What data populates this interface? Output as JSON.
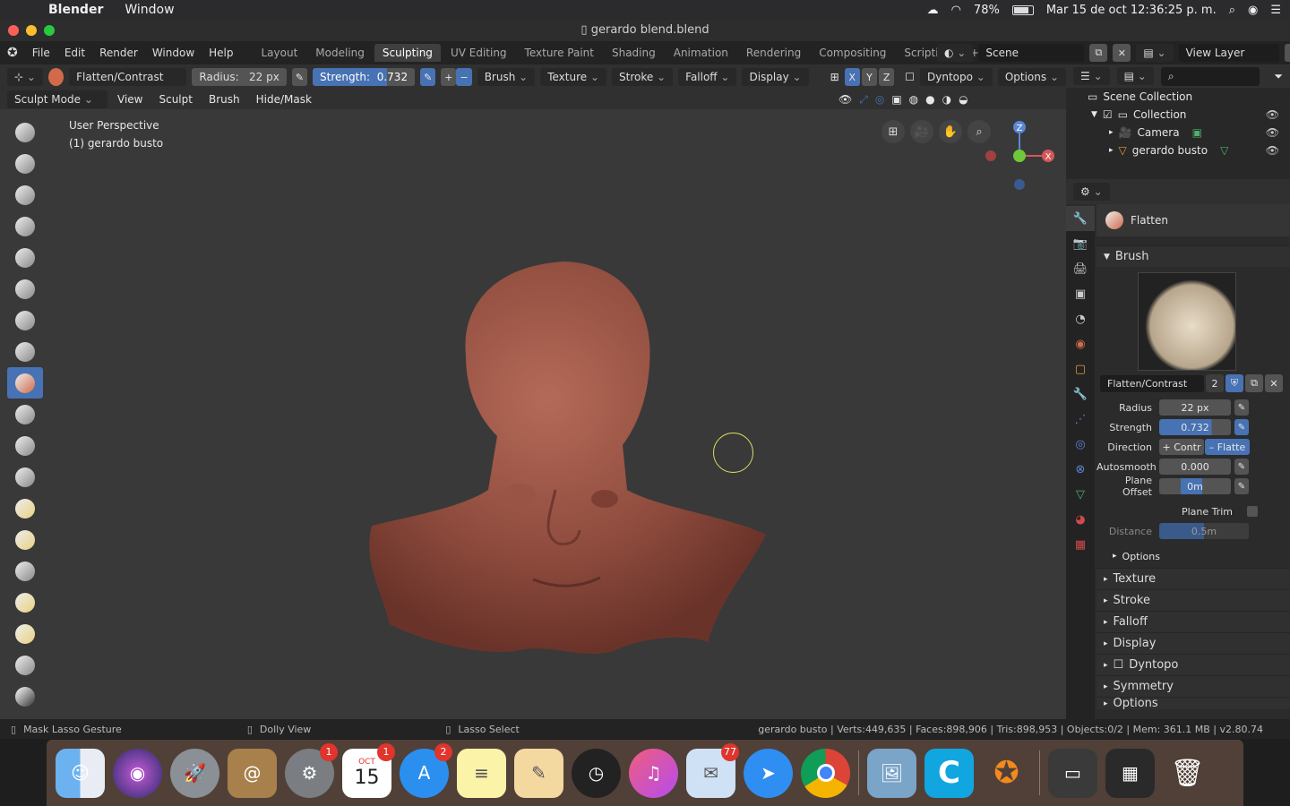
{
  "menubar": {
    "app": "Blender",
    "window": "Window",
    "battery": "78%",
    "datetime": "Mar 15 de oct  12:36:25 p. m."
  },
  "titlebar": {
    "title": "gerardo blend.blend"
  },
  "topmenu": [
    "File",
    "Edit",
    "Render",
    "Window",
    "Help"
  ],
  "workspaces": [
    "Layout",
    "Modeling",
    "Sculpting",
    "UV Editing",
    "Texture Paint",
    "Shading",
    "Animation",
    "Rendering",
    "Compositing",
    "Scripting"
  ],
  "active_workspace": "Sculpting",
  "scene": {
    "scene_label": "Scene",
    "view_layer_label": "View Layer"
  },
  "tool_header": {
    "brush_name": "Flatten/Contrast",
    "radius_label": "Radius:",
    "radius_value": "22 px",
    "strength_label": "Strength:",
    "strength_value": "0.732",
    "menus": [
      "Brush",
      "Texture",
      "Stroke",
      "Falloff",
      "Display"
    ],
    "x": "X",
    "y": "Y",
    "z": "Z",
    "dyntopo": "Dyntopo",
    "options": "Options"
  },
  "mode_header": {
    "mode": "Sculpt Mode",
    "menus": [
      "View",
      "Sculpt",
      "Brush",
      "Hide/Mask"
    ]
  },
  "viewport": {
    "perspective": "User Perspective",
    "object": "(1) gerardo busto"
  },
  "gizmo": {
    "z": "Z",
    "x": "X"
  },
  "outliner": {
    "root": "Scene Collection",
    "collection": "Collection",
    "camera": "Camera",
    "object": "gerardo busto"
  },
  "properties": {
    "brush_tool": "Flatten",
    "brush_section": "Brush",
    "brush_datablock": "Flatten/Contrast",
    "users": "2",
    "radius": {
      "label": "Radius",
      "value": "22 px"
    },
    "strength": {
      "label": "Strength",
      "value": "0.732"
    },
    "direction": {
      "label": "Direction",
      "contrast": "+ Contr",
      "flatten": "– Flatte"
    },
    "autosmooth": {
      "label": "Autosmooth",
      "value": "0.000"
    },
    "plane_offset": {
      "label": "Plane Offset",
      "value": "0m"
    },
    "plane_trim": "Plane Trim",
    "distance": {
      "label": "Distance",
      "value": "0.5m"
    },
    "options": "Options",
    "sections": [
      "Texture",
      "Stroke",
      "Falloff",
      "Display",
      "Dyntopo",
      "Symmetry"
    ],
    "more": "Options"
  },
  "status": {
    "mask": "Mask Lasso Gesture",
    "dolly": "Dolly View",
    "lasso": "Lasso Select",
    "stats": "gerardo busto | Verts:449,635 | Faces:898,906 | Tris:898,953 | Objects:0/2 | Mem: 361.1 MB | v2.80.74"
  },
  "dock": {
    "calendar_month": "OCT",
    "calendar_day": "15",
    "badge_prefs": "1",
    "badge_cal": "1",
    "badge_appstore": "2",
    "badge_mail": "77"
  }
}
